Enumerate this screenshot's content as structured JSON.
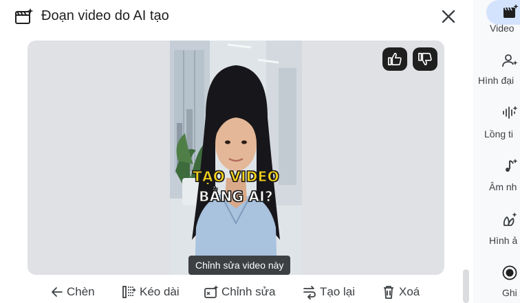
{
  "header": {
    "title": "Đoạn video do AI tạo"
  },
  "video": {
    "caption_line1": "TẠO VIDEO",
    "caption_line2": "BẰNG AI?",
    "edit_tooltip": "Chỉnh sửa video này"
  },
  "actions": [
    {
      "label": "Chèn",
      "icon": "arrow-left-icon"
    },
    {
      "label": "Kéo dài",
      "icon": "extend-icon"
    },
    {
      "label": "Chỉnh sửa",
      "icon": "magic-edit-icon"
    },
    {
      "label": "Tạo lại",
      "icon": "regenerate-icon"
    },
    {
      "label": "Xoá",
      "icon": "trash-icon"
    }
  ],
  "rail": [
    {
      "label": "Video",
      "icon": "video-sparkle-icon",
      "active": true
    },
    {
      "label": "Hình đại",
      "icon": "avatar-sparkle-icon"
    },
    {
      "label": "Lồng ti",
      "icon": "voiceover-icon"
    },
    {
      "label": "Âm nh",
      "icon": "music-note-icon"
    },
    {
      "label": "Hình ả",
      "icon": "image-sparkle-icon"
    },
    {
      "label": "Ghi",
      "icon": "record-icon"
    }
  ],
  "colors": {
    "accent": "#d3e3fd",
    "caption_yellow": "#f6d21b",
    "tooltip_bg": "#3c4043"
  }
}
